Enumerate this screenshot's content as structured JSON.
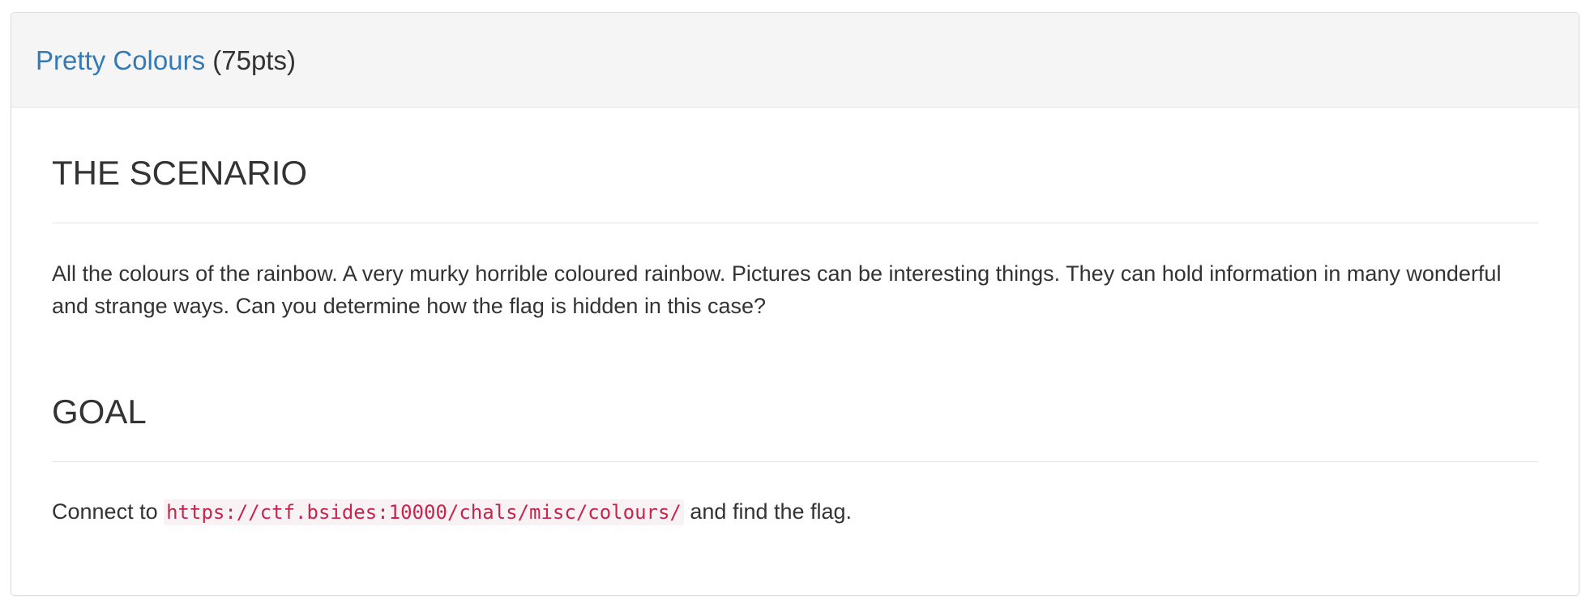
{
  "challenge": {
    "title": "Pretty Colours",
    "points": "(75pts)"
  },
  "scenario": {
    "heading": "THE SCENARIO",
    "text": "All the colours of the rainbow. A very murky horrible coloured rainbow. Pictures can be interesting things. They can hold information in many wonderful and strange ways. Can you determine how the flag is hidden in this case?"
  },
  "goal": {
    "heading": "GOAL",
    "prefix": "Connect to",
    "url": "https://ctf.bsides:10000/chals/misc/colours/",
    "suffix": "and find the flag."
  },
  "colors": {
    "link": "#337ab7",
    "code_text": "#c7254e",
    "code_bg": "#f9f2f4",
    "heading_bg": "#f5f5f5"
  }
}
